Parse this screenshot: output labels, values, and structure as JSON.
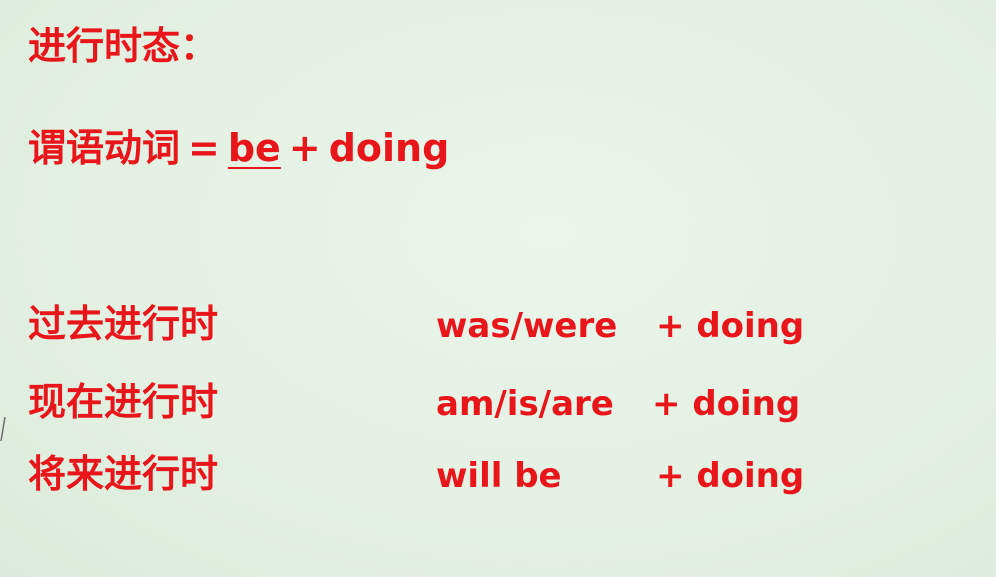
{
  "title": "进行时态：",
  "formula": {
    "label": "谓语动词",
    "equals": "=",
    "be": "be",
    "plus": "+",
    "doing": "doing"
  },
  "rows": [
    {
      "tense": "过去进行时",
      "aux": "was/were",
      "plus_doing": "+ doing"
    },
    {
      "tense": "现在进行时",
      "aux": "am/is/are",
      "plus_doing": "+ doing"
    },
    {
      "tense": "将来进行时",
      "aux": "will be",
      "plus_doing": "+ doing"
    }
  ],
  "colors": {
    "text": "#e8151b",
    "background": "#e6f1e5"
  }
}
